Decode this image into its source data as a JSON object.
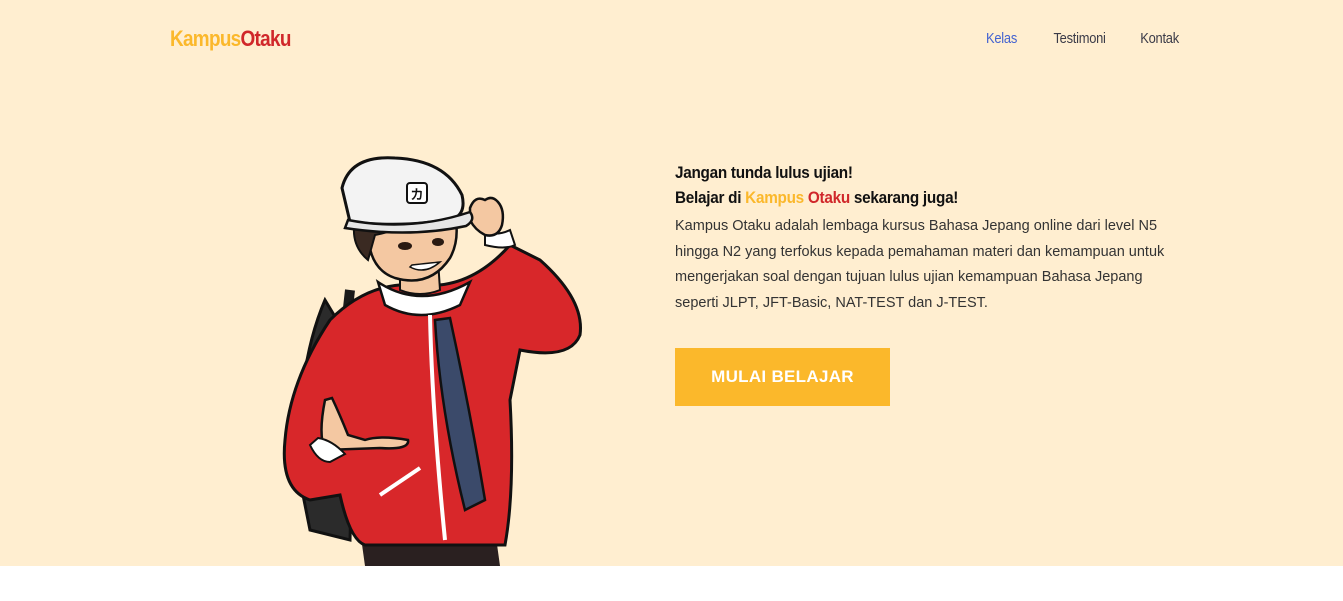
{
  "brand": {
    "part1": "Kampus",
    "part2": "Otaku"
  },
  "nav": {
    "items": [
      "Kelas",
      "Testimoni",
      "Kontak"
    ]
  },
  "hero": {
    "headline_line1": "Jangan tunda lulus ujian!",
    "headline_prefix": "Belajar di ",
    "headline_brand1": "Kampus",
    "headline_space": " ",
    "headline_brand2": "Otaku",
    "headline_suffix": " sekarang juga!",
    "description": "Kampus Otaku adalah lembaga kursus Bahasa Jepang online dari level N5 hingga N2 yang terfokus kepada pemahaman materi dan kemampuan untuk mengerjakan soal dengan tujuan lulus ujian kemampuan Bahasa Jepang seperti JLPT, JFT-Basic, NAT-TEST dan J-TEST.",
    "cta_label": "MULAI BELAJAR",
    "cap_glyph": "カ"
  },
  "colors": {
    "background": "#ffeed0",
    "brand_yellow": "#fbb82b",
    "brand_red": "#d0272a",
    "nav_active": "#4463d0"
  }
}
